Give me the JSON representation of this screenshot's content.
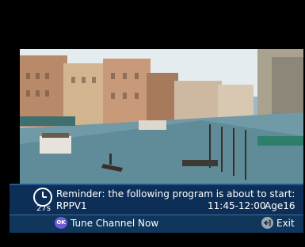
{
  "reminder": {
    "message": "Reminder: the following program is about to start:",
    "countdown": "27s",
    "channel": "RPPV1",
    "time_range": "11:45-12:00",
    "age_rating": "Age16"
  },
  "footer": {
    "ok_icon_text": "OK",
    "tune_label": "Tune Channel Now",
    "exit_label": "Exit"
  },
  "icons": {
    "clock": "clock-icon",
    "ok": "ok-button-icon",
    "exit": "exit-icon"
  },
  "colors": {
    "bar": "#10365c",
    "ok_button": "#6e5bd8",
    "text": "#ffffff"
  }
}
